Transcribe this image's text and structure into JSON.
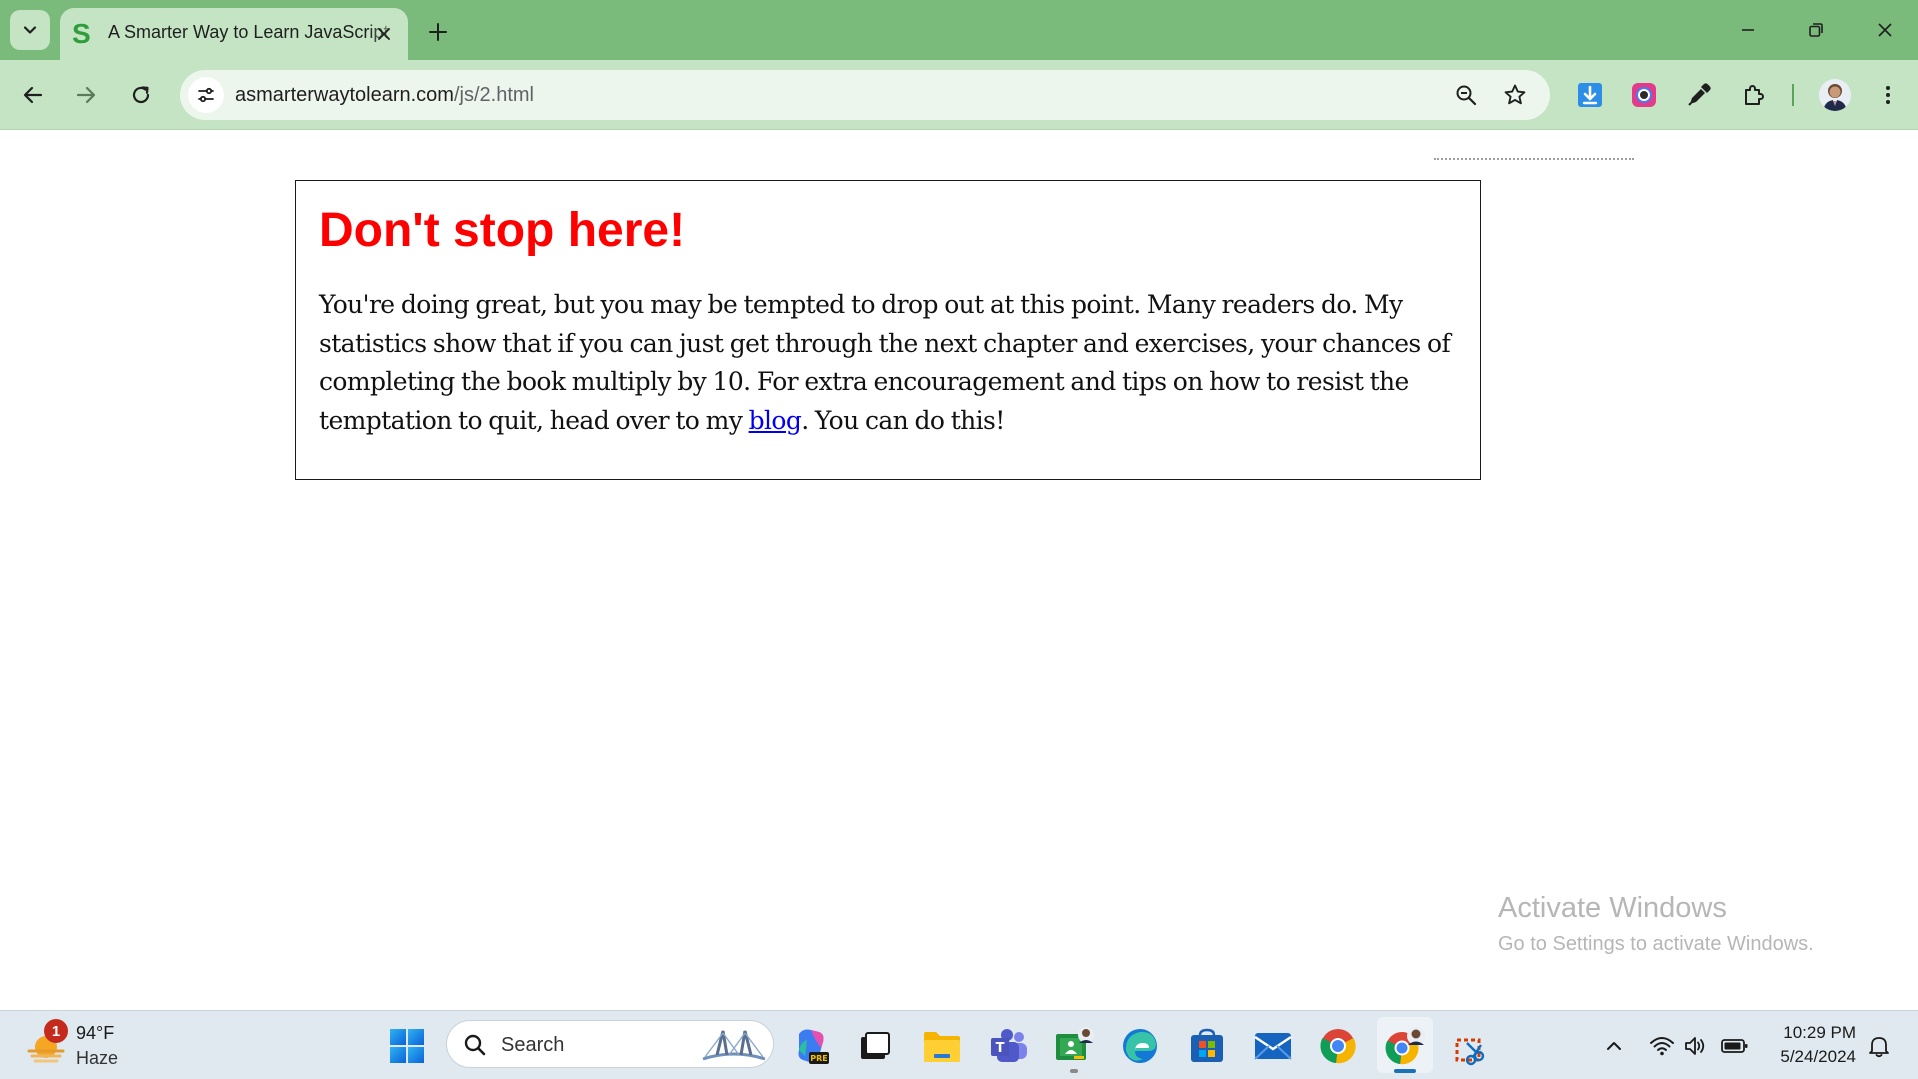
{
  "browser": {
    "tab": {
      "title": "A Smarter Way to Learn JavaScript",
      "favicon_letter": "S"
    },
    "address_bar": {
      "domain": "asmarterwaytolearn.com",
      "path": "/js/2.html"
    },
    "colors": {
      "frame": "#7aba7a",
      "toolbar": "#c4e4c4",
      "omnibox": "#edf6ed"
    }
  },
  "page": {
    "callout": {
      "heading": "Don't stop here!",
      "body_before_link": "You're doing great, but you may be tempted to drop out at this point. Many readers do. My statistics show that if you can just get through the next chapter and exercises, your chances of completing the book multiply by 10. For extra encouragement and tips on how to resist the temptation to quit, head over to my ",
      "link_text": "blog",
      "body_after_link": ". You can do this!",
      "heading_color": "#ff0000",
      "link_color": "#0000ee"
    }
  },
  "watermark": {
    "line1": "Activate Windows",
    "line2": "Go to Settings to activate Windows."
  },
  "taskbar": {
    "weather": {
      "badge": "1",
      "temperature": "94°F",
      "condition": "Haze"
    },
    "search_label": "Search",
    "pinned_icons": [
      "windows-start-icon",
      "search-icon",
      "copilot-icon",
      "task-view-icon",
      "file-explorer-icon",
      "teams-icon",
      "classroom-icon",
      "edge-icon",
      "store-icon",
      "mail-icon",
      "chrome-icon",
      "chrome-profile-icon",
      "snipping-tool-icon"
    ],
    "tray_icons": [
      "chevron-up-icon",
      "wifi-icon",
      "volume-icon",
      "battery-icon",
      "notification-bell-icon"
    ],
    "clock": {
      "time": "10:29 PM",
      "date": "5/24/2024"
    }
  }
}
